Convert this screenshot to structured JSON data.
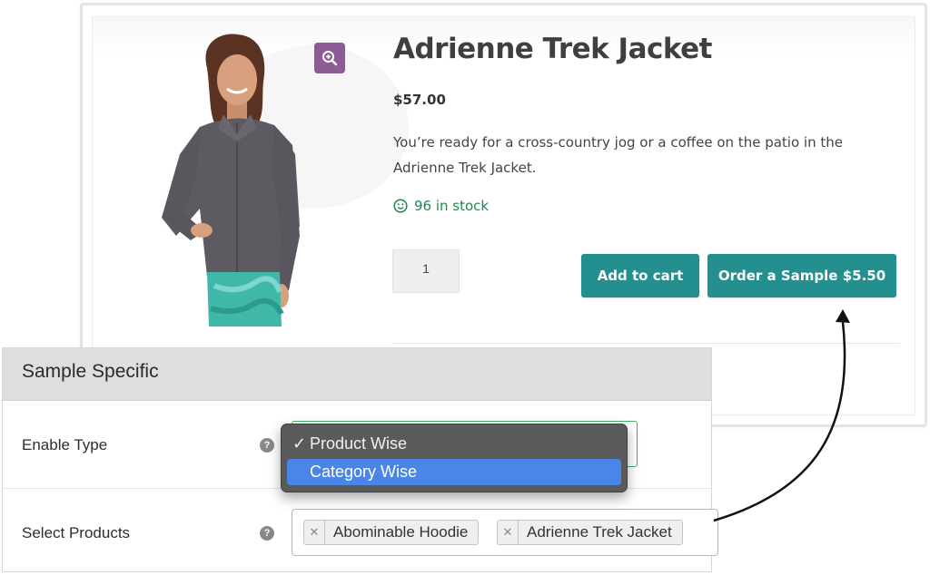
{
  "product": {
    "title": "Adrienne Trek Jacket",
    "price": "$57.00",
    "description": "You’re ready for a cross-country jog or a coffee on the patio in the Adrienne Trek Jacket.",
    "stock": "96 in stock",
    "quantity": "1",
    "add_to_cart_label": "Add to cart",
    "order_sample_label": "Order a Sample $5.50"
  },
  "settings": {
    "panel_title": "Sample Specific",
    "enable_type_label": "Enable Type",
    "select_products_label": "Select Products",
    "enable_type_options": [
      {
        "label": "Product Wise",
        "checked": true
      },
      {
        "label": "Category Wise",
        "highlighted": true
      }
    ],
    "selected_products": [
      "Abominable Hoodie",
      "Adrienne Trek Jacket"
    ]
  },
  "colors": {
    "button": "#23908f",
    "zoom_button": "#8d5c96",
    "stock": "#1d8a4d",
    "dropdown_highlight": "#4a86e8",
    "enable_type_border": "#3cae6a"
  },
  "icons": [
    "zoom-in-icon",
    "smiley-icon",
    "help-icon",
    "remove-chip-icon",
    "checkmark-icon"
  ]
}
